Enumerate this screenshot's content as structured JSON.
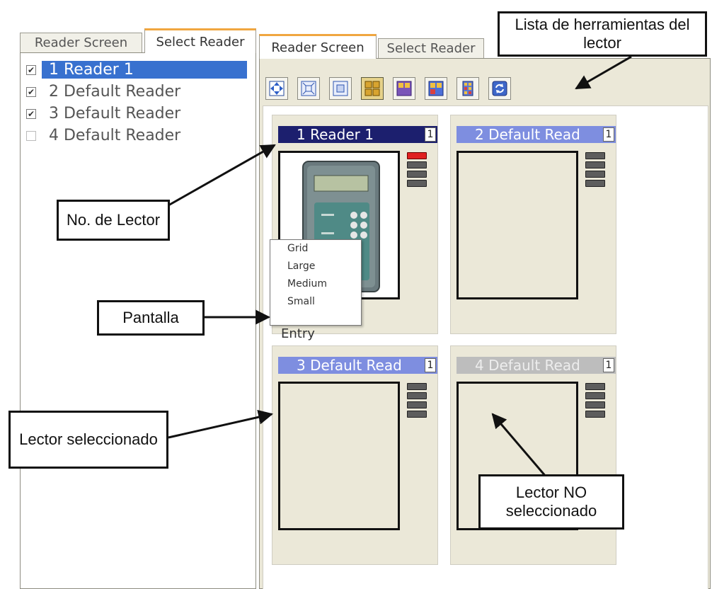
{
  "left_panel": {
    "tabs": [
      {
        "label": "Reader Screen"
      },
      {
        "label": "Select Reader"
      }
    ],
    "readers": [
      {
        "label": "1  Reader 1",
        "checked": true,
        "selected": true
      },
      {
        "label": "2  Default Reader",
        "checked": true,
        "selected": false
      },
      {
        "label": "3  Default Reader",
        "checked": true,
        "selected": false
      },
      {
        "label": "4  Default Reader",
        "checked": false,
        "selected": false
      }
    ]
  },
  "right_panel": {
    "tabs": [
      {
        "label": "Reader Screen"
      },
      {
        "label": "Select Reader"
      }
    ],
    "toolbar": [
      {
        "icon": "pan-icon"
      },
      {
        "icon": "fit-icon"
      },
      {
        "icon": "center-icon"
      },
      {
        "icon": "grid-icon",
        "selected": true
      },
      {
        "icon": "large-view-icon"
      },
      {
        "icon": "medium-view-icon"
      },
      {
        "icon": "small-view-icon"
      },
      {
        "icon": "refresh-icon"
      }
    ],
    "cells": [
      {
        "title": "1  Reader 1",
        "num": "1",
        "title_bg": "#1c1f6e",
        "title_color": "#ffffff"
      },
      {
        "title": "2  Default Read",
        "num": "1",
        "title_bg": "#7e8ee0",
        "title_color": "#ffffff"
      },
      {
        "title": "3  Default Read",
        "num": "1",
        "title_bg": "#7e8ee0",
        "title_color": "#ffffff"
      },
      {
        "title": "4  Default Read",
        "num": "1",
        "title_bg": "#bdbdbd",
        "title_color": "#ededed"
      }
    ],
    "entry_label": "Entry",
    "context_menu": [
      "Grid",
      "Large",
      "Medium",
      "Small"
    ]
  },
  "callouts": {
    "toolbar_list": "Lista de herramientas del lector",
    "reader_no": "No. de Lector",
    "screen": "Pantalla",
    "selected": "Lector seleccionado",
    "not_selected": "Lector NO seleccionado"
  }
}
